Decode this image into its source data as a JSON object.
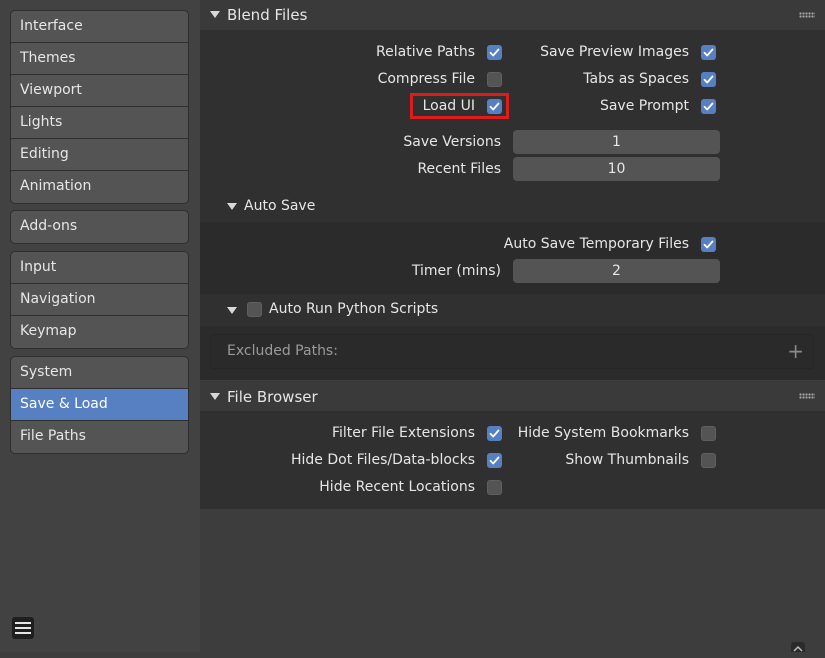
{
  "sidebar": {
    "groups": [
      [
        "Interface",
        "Themes",
        "Viewport",
        "Lights",
        "Editing",
        "Animation"
      ],
      [
        "Add-ons"
      ],
      [
        "Input",
        "Navigation",
        "Keymap"
      ],
      [
        "System",
        "Save & Load",
        "File Paths"
      ]
    ],
    "active": "Save & Load"
  },
  "blend_files": {
    "title": "Blend Files",
    "relative_paths": {
      "label": "Relative Paths",
      "checked": true
    },
    "compress_file": {
      "label": "Compress File",
      "checked": false
    },
    "load_ui": {
      "label": "Load UI",
      "checked": true
    },
    "save_preview_images": {
      "label": "Save Preview Images",
      "checked": true
    },
    "tabs_as_spaces": {
      "label": "Tabs as Spaces",
      "checked": true
    },
    "save_prompt": {
      "label": "Save Prompt",
      "checked": true
    },
    "save_versions": {
      "label": "Save Versions",
      "value": "1"
    },
    "recent_files": {
      "label": "Recent Files",
      "value": "10"
    }
  },
  "auto_save": {
    "title": "Auto Save",
    "temp_files": {
      "label": "Auto Save Temporary Files",
      "checked": true
    },
    "timer": {
      "label": "Timer (mins)",
      "value": "2"
    }
  },
  "auto_run": {
    "title": "Auto Run Python Scripts",
    "checked": false,
    "excluded_paths_label": "Excluded Paths:",
    "add_icon": "+"
  },
  "file_browser": {
    "title": "File Browser",
    "filter_extensions": {
      "label": "Filter File Extensions",
      "checked": true
    },
    "hide_dot_files": {
      "label": "Hide Dot Files/Data-blocks",
      "checked": true
    },
    "hide_recent": {
      "label": "Hide Recent Locations",
      "checked": false
    },
    "hide_system_bookmarks": {
      "label": "Hide System Bookmarks",
      "checked": false
    },
    "show_thumbnails": {
      "label": "Show Thumbnails",
      "checked": false
    }
  },
  "colors": {
    "accent": "#5680c2",
    "highlight": "#e01b1b",
    "panel": "#303030",
    "background": "#3d3d3d"
  }
}
